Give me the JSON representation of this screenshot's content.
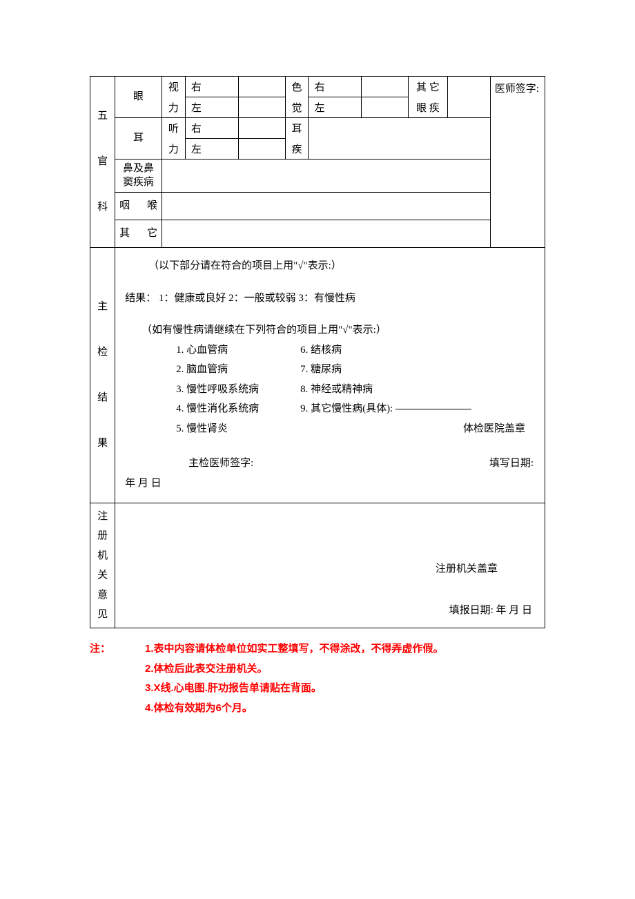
{
  "section_five": {
    "label": "五官科",
    "eye": {
      "label": "眼",
      "vision_label": "视力",
      "right": "右",
      "left": "左",
      "color_label": "色觉",
      "color_right": "右",
      "color_left": "左",
      "other_label": "其 它眼 疾"
    },
    "ear": {
      "label": "耳",
      "hearing_label": "听力",
      "right": "右",
      "left": "左",
      "disease_label": "耳疾"
    },
    "nose": {
      "label": "鼻及鼻窦疾病"
    },
    "throat": {
      "label": "咽    喉"
    },
    "other": {
      "label": "其    它"
    },
    "doctor_sign": "医师签字:"
  },
  "main_result": {
    "label": "主检结果",
    "instruction": "（以下部分请在符合的项目上用\"√\"表示:）",
    "result_line": "结果：  1：健康或良好       2：一般或较弱        3：有慢性病",
    "chronic_instruction": "（如有慢性病请继续在下列符合的项目上用\"√\"表示:）",
    "d1": "1. 心血管病",
    "d2": "2. 脑血管病",
    "d3": "3. 慢性呼吸系统病",
    "d4": "4. 慢性消化系统病",
    "d5": "5. 慢性肾炎",
    "d6": "6. 结核病",
    "d7": "7. 糖尿病",
    "d8": "8. 神经或精神病",
    "d9": "9. 其它慢性病(具体):",
    "hospital_stamp": "体检医院盖章",
    "chief_sign": "主检医师签字:",
    "fill_date": "填写日期:",
    "date_suffix": "年    月    日"
  },
  "registration": {
    "label": "注册机关意见",
    "stamp": "注册机关盖章",
    "report_date": "填报日期:     年    月    日"
  },
  "notes": {
    "label": "注：",
    "n1": "1.表中内容请体检单位如实工整填写，不得涂改，不得弄虚作假。",
    "n2": "2.体检后此表交注册机关。",
    "n3": "3.X线.心电图.肝功报告单请贴在背面。",
    "n4": "4.体检有效期为6个月。"
  }
}
